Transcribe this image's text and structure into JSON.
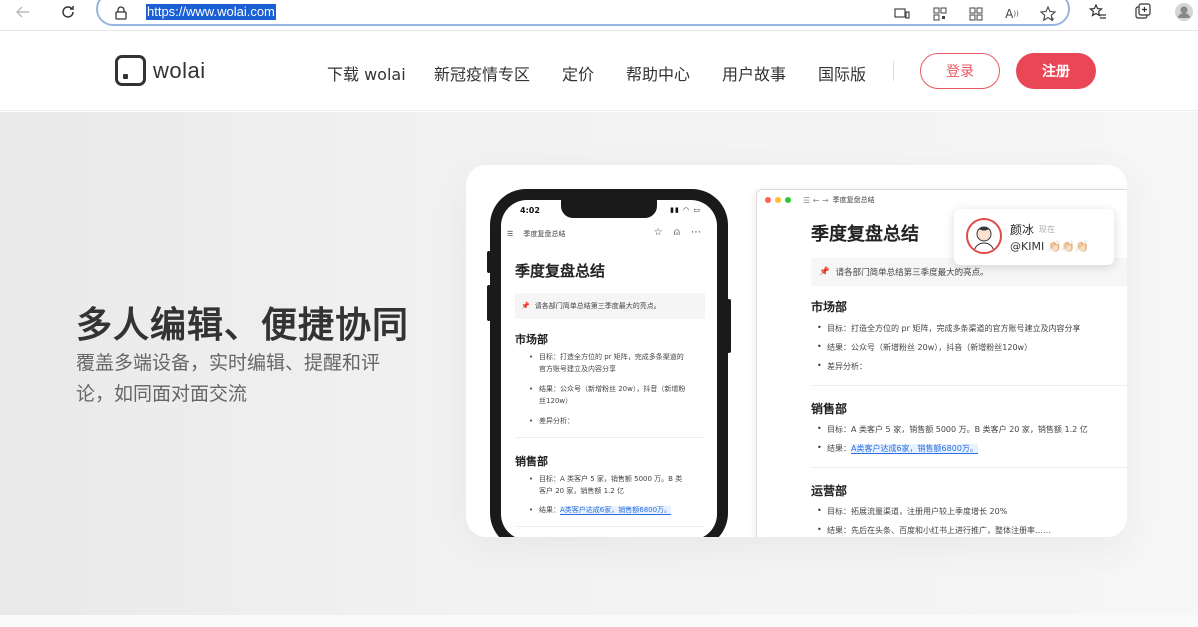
{
  "browser": {
    "url": "https://www.wolai.com",
    "icons": [
      "back-arrow-icon",
      "refresh-icon",
      "lock-icon",
      "device-icon",
      "qr-code-icon",
      "apps-icon",
      "read-aloud-icon",
      "add-favorite-icon",
      "favorites-icon",
      "collections-icon",
      "profile-icon"
    ]
  },
  "header": {
    "logo_text": "wolai",
    "nav": [
      "下载 wolai",
      "新冠疫情专区",
      "定价",
      "帮助中心",
      "用户故事",
      "国际版"
    ],
    "login_label": "登录",
    "signup_label": "注册",
    "accent_color": "#ea4756"
  },
  "hero": {
    "title": "多人编辑、便捷协同",
    "subtitle": "覆盖多端设备，实时编辑、提醒和评论，如同面对面交流"
  },
  "desktop_doc": {
    "breadcrumb": "季度复盘总结",
    "title": "季度复盘总结",
    "callout": "请各部门简单总结第三季度最大的亮点。",
    "sections": [
      {
        "heading": "市场部",
        "items": [
          "目标：打造全方位的 pr 矩阵，完成多条渠道的官方账号建立及内容分享",
          "结果：公众号（新增粉丝 20w），抖音（新增粉丝120w）",
          "差异分析："
        ]
      },
      {
        "heading": "销售部",
        "items": [
          "目标：A 类客户 5 家，销售额 5000 万。B 类客户 20 家，销售额 1.2 亿",
          "结果：",
          "A类客户达成6家，销售额6800万。"
        ]
      },
      {
        "heading": "运营部",
        "items": [
          "目标：拓展流量渠道，注册用户较上季度增长 20%",
          "结果：先后在头条、百度和小红书上进行推广，整体注册率……"
        ]
      }
    ],
    "comment": {
      "name": "颜冰",
      "time": "现在",
      "message": "@KIMI 👏🏻👏🏻👏🏻"
    }
  },
  "phone_doc": {
    "time": "4:02",
    "breadcrumb": "季度复盘总结",
    "title": "季度复盘总结",
    "callout": "请各部门简单总结第三季度最大的亮点。",
    "sections": [
      {
        "heading": "市场部",
        "items": [
          "目标：打造全方位的 pr 矩阵，完成多条渠道的官方账号建立及内容分享",
          "结果：公众号（新增粉丝 20w），抖音（新增粉丝120w）",
          "差异分析："
        ]
      },
      {
        "heading": "销售部",
        "items": [
          "目标：A 类客户 5 家，销售额 5000 万。B 类客户 20 家，销售额 1.2 亿",
          "结果：",
          "A类客户达成6家，销售额6800万。"
        ]
      }
    ]
  }
}
